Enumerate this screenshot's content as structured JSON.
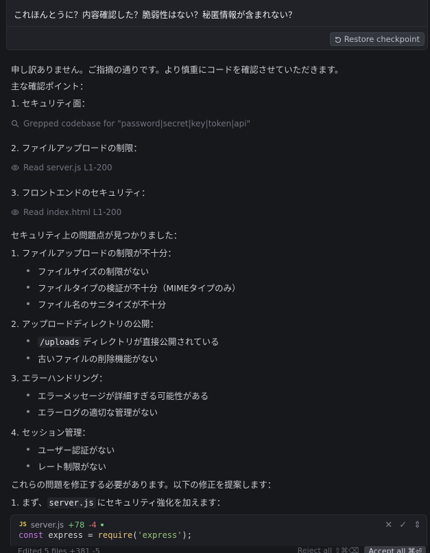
{
  "user_message": {
    "text": "これほんとうに？内容確認した？脆弱性はない？秘匿情報が含まれない？",
    "restore_label": "Restore checkpoint"
  },
  "assistant": {
    "intro": "申し訳ありません。ご指摘の通りです。より慎重にコードを確認させていただきます。",
    "points_heading": "主な確認ポイント：",
    "point1": "1. セキュリティ面：",
    "tool_grep": "Grepped codebase for \"password|secret|key|token|api\"",
    "point2": "2. ファイルアップロードの制限：",
    "tool_read_server": "Read server.js L1-200",
    "point3": "3. フロントエンドのセキュリティ：",
    "tool_read_index": "Read index.html L1-200",
    "issues_heading": "セキュリティ上の問題点が見つかりました：",
    "issue1": "1. ファイルアップロードの制限が不十分：",
    "issue1_items": [
      "ファイルサイズの制限がない",
      "ファイルタイプの検証が不十分（MIMEタイプのみ）",
      "ファイル名のサニタイズが不十分"
    ],
    "issue2": "2. アップロードディレクトリの公開：",
    "issue2_code": "/uploads",
    "issue2_item1_rest": "ディレクトリが直接公開されている",
    "issue2_item2": "古いファイルの削除機能がない",
    "issue3": "3. エラーハンドリング：",
    "issue3_items": [
      "エラーメッセージが詳細すぎる可能性がある",
      "エラーログの適切な管理がない"
    ],
    "issue4": "4. セッション管理：",
    "issue4_items": [
      "ユーザー認証がない",
      "レート制限がない"
    ],
    "fix_heading": "これらの問題を修正する必要があります。以下の修正を提案します：",
    "fix1_prefix": "1. まず、",
    "fix1_code": "server.js",
    "fix1_suffix": "にセキュリティ強化を加えます："
  },
  "code_card": {
    "badge": "JS",
    "filename": "server.js",
    "added": "+78",
    "removed": "-4",
    "code_kw": "const",
    "code_var": "express",
    "code_eq": "=",
    "code_fn": "require",
    "code_str": "'express'",
    "code_end": ");"
  },
  "footer": {
    "edited": "Edited 5 files +381 -5",
    "reject": "Reject all ⇧⌘⌫",
    "accept": "Accept all ⌘⏎"
  }
}
